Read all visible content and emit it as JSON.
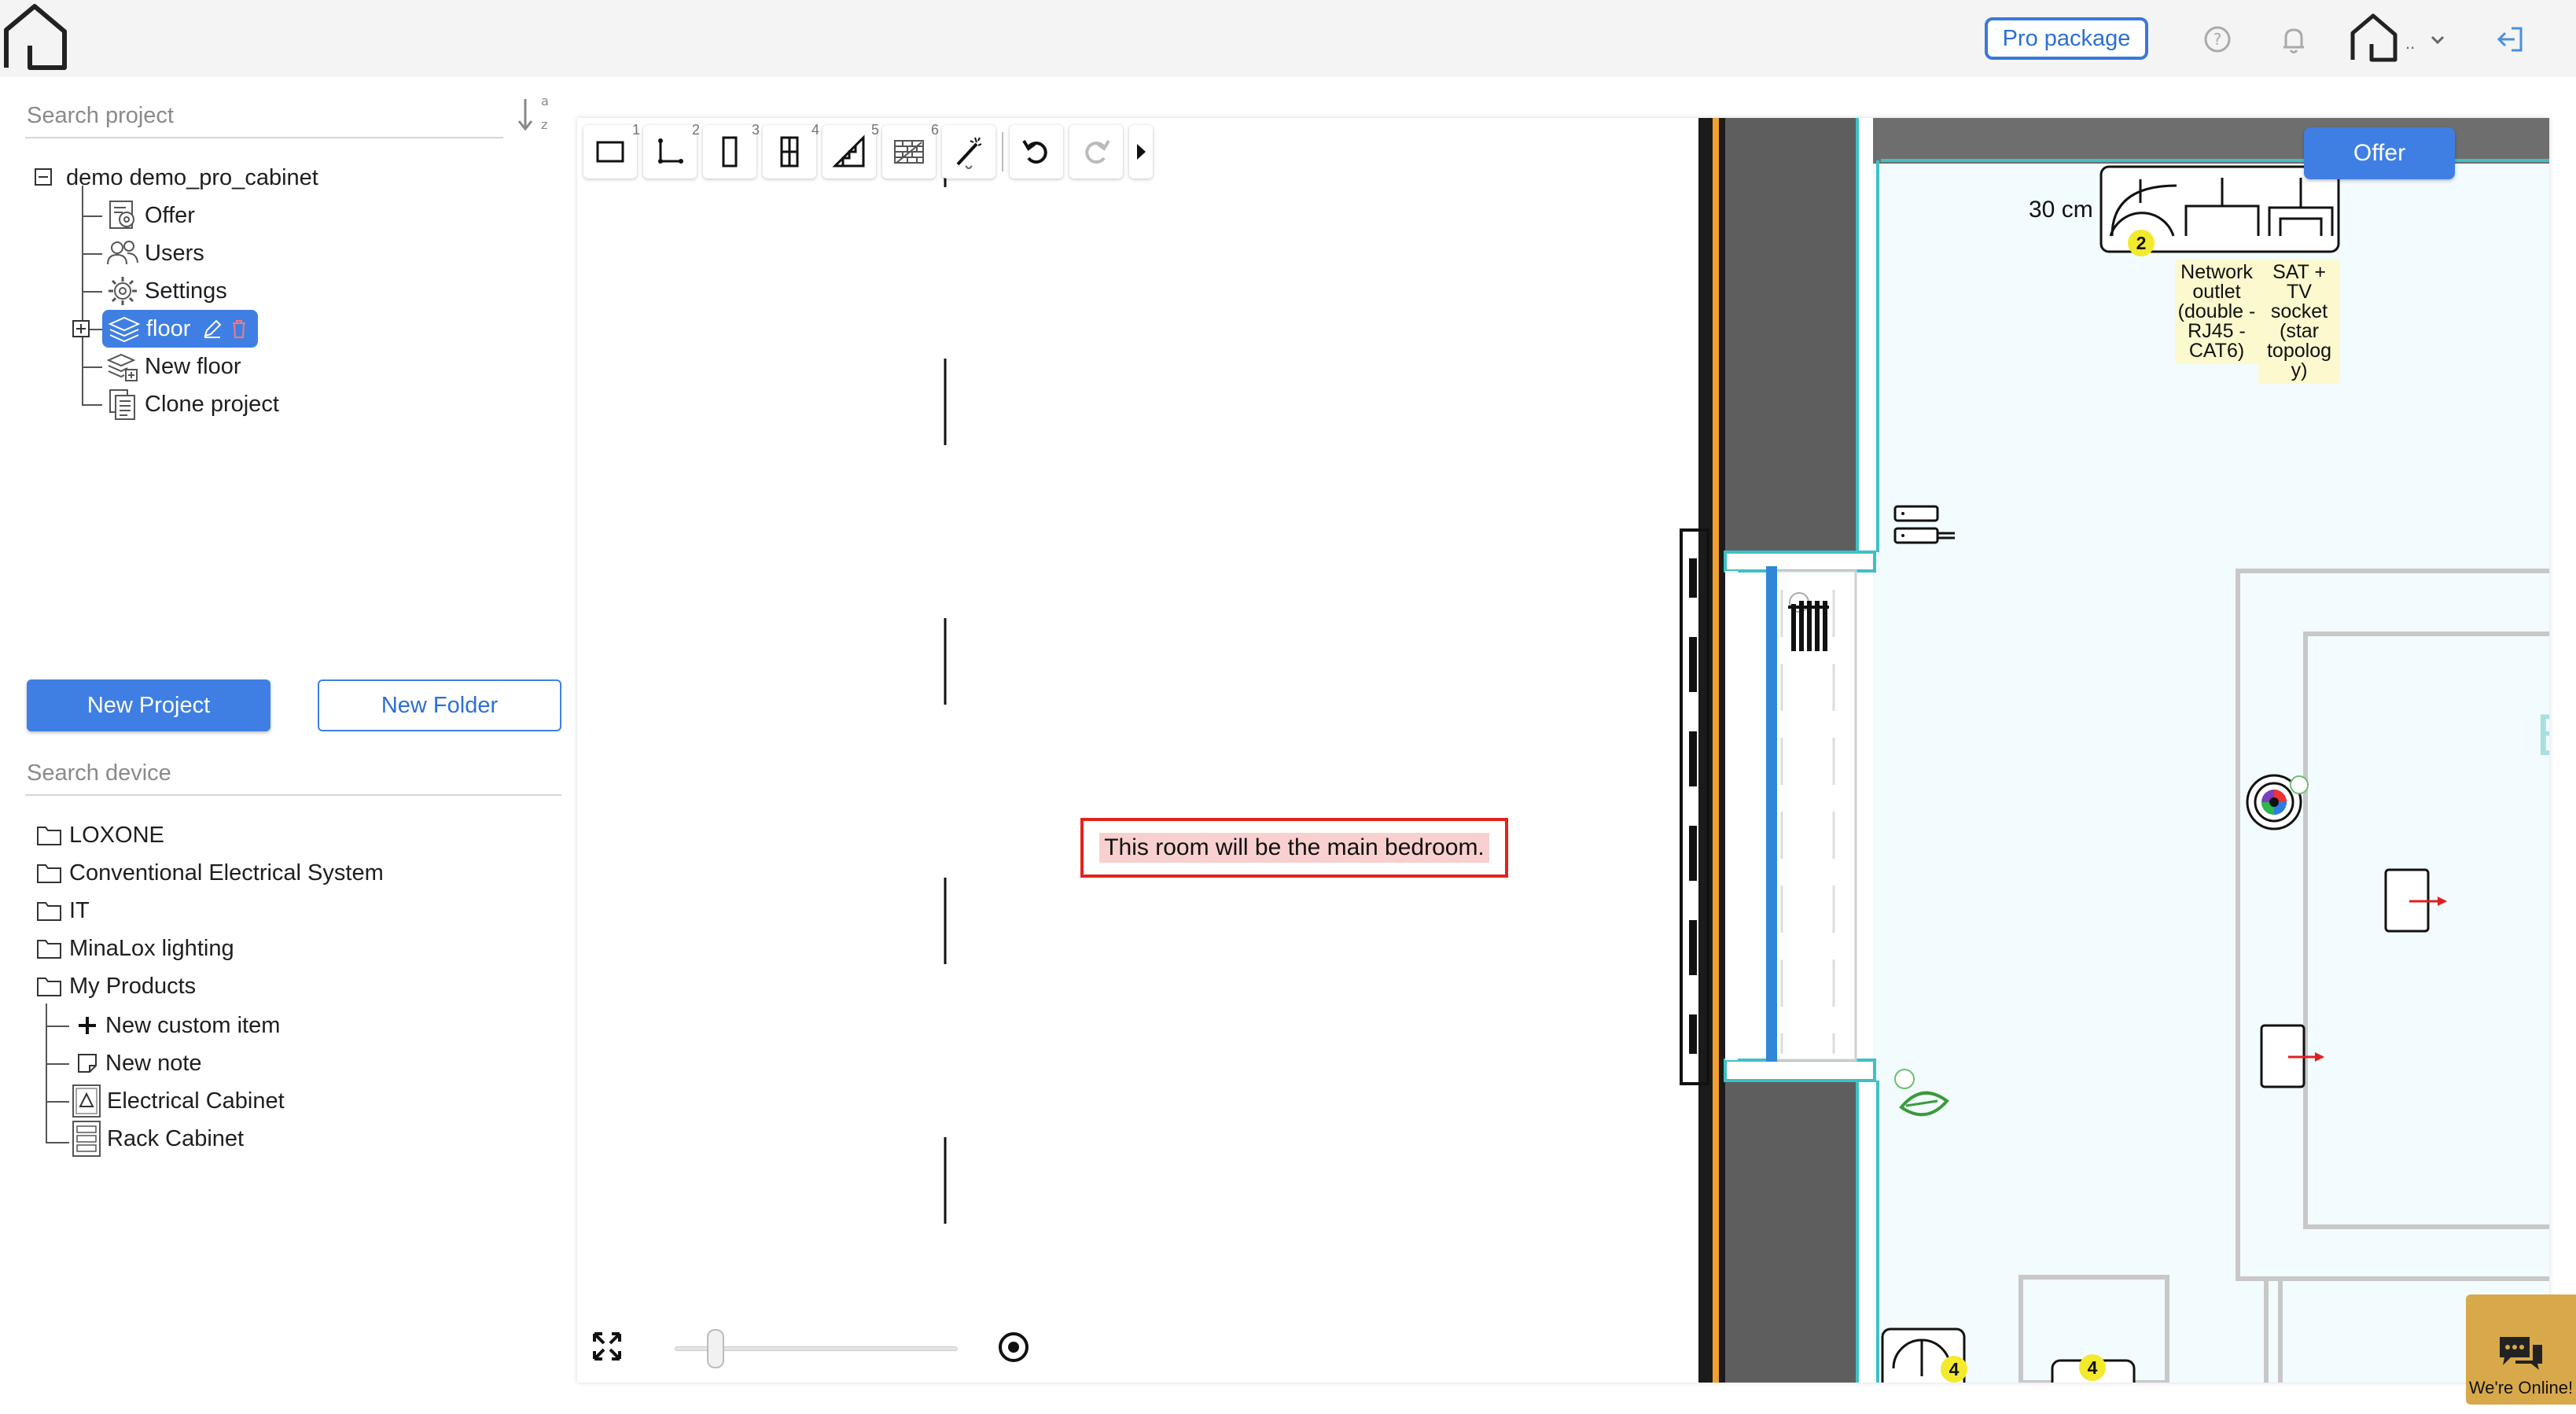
{
  "header": {
    "pro_package_label": "Pro package",
    "account_dots": ".."
  },
  "project_panel": {
    "search_placeholder": "Search project",
    "sort_label_top": "a",
    "sort_label_bottom": "z",
    "project_name": "demo demo_pro_cabinet",
    "items": [
      {
        "label": "Offer",
        "icon": "offer-settings-icon"
      },
      {
        "label": "Users",
        "icon": "users-icon"
      },
      {
        "label": "Settings",
        "icon": "gear-icon"
      },
      {
        "label": "floor",
        "icon": "layers-icon",
        "selected": true
      },
      {
        "label": "New floor",
        "icon": "new-floor-icon"
      },
      {
        "label": "Clone project",
        "icon": "clone-icon"
      }
    ],
    "new_project_label": "New Project",
    "new_folder_label": "New Folder"
  },
  "device_panel": {
    "search_placeholder": "Search device",
    "folders": [
      {
        "label": "LOXONE"
      },
      {
        "label": "Conventional Electrical System"
      },
      {
        "label": "IT"
      },
      {
        "label": "MinaLox lighting"
      },
      {
        "label": "My Products"
      }
    ],
    "my_products_children": [
      {
        "label": "New custom item",
        "icon": "plus-icon"
      },
      {
        "label": "New note",
        "icon": "note-icon"
      },
      {
        "label": "Electrical Cabinet",
        "icon": "electrical-cabinet-icon"
      },
      {
        "label": "Rack Cabinet",
        "icon": "rack-cabinet-icon"
      }
    ]
  },
  "toolbar": {
    "tools": [
      {
        "num": "1",
        "icon": "rectangle-room-icon"
      },
      {
        "num": "2",
        "icon": "wall-polyline-icon"
      },
      {
        "num": "3",
        "icon": "door-icon"
      },
      {
        "num": "4",
        "icon": "window-icon"
      },
      {
        "num": "5",
        "icon": "stairs-icon"
      },
      {
        "num": "6",
        "icon": "brick-wall-icon"
      }
    ]
  },
  "canvas": {
    "offer_label": "Offer",
    "note_text": "This room will be the main bedroom.",
    "dimension_label": "30 cm",
    "network_outlet_label": "Network outlet (double - RJ45 - CAT6)",
    "sat_socket_label": "SAT + TV socket (star topolog y)",
    "badge_top": "2",
    "badge_bottom_left": "4",
    "badge_bottom_right": "4",
    "zoom_level": 0.12
  },
  "chat": {
    "label": "We're Online!"
  },
  "colors": {
    "accent": "#3f7fe3",
    "room_fill": "#f2fbfe",
    "room_outline": "#3ec0c4",
    "wall": "#5e5e5e",
    "note_border": "#e2231a",
    "badge": "#f3ea2e"
  }
}
